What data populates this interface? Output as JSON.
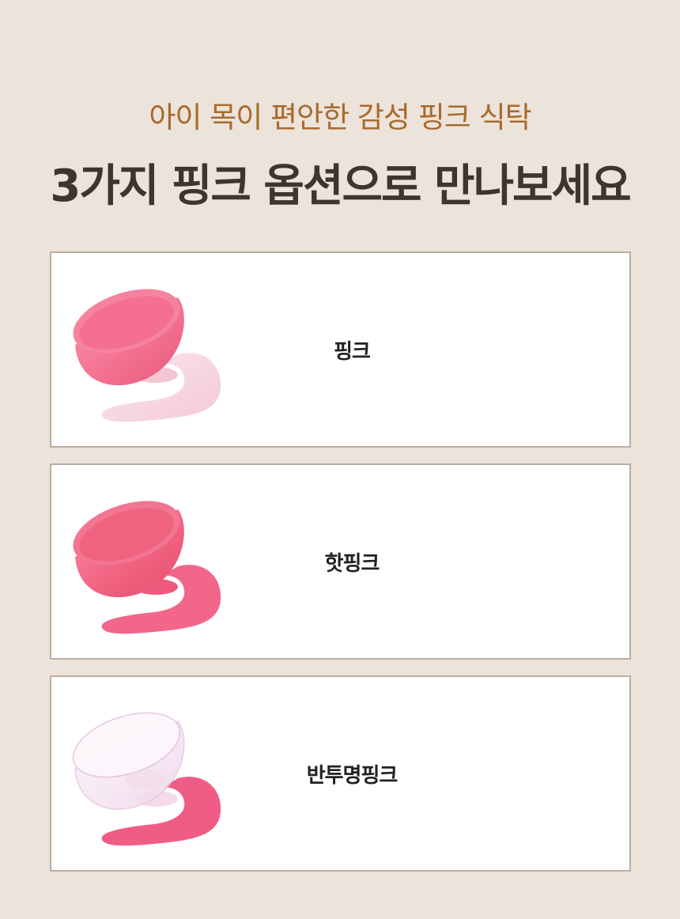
{
  "header": {
    "subtitle": "아이 목이 편안한 감성 핑크 식탁",
    "title": "3가지 핑크 옵션으로 만나보세요"
  },
  "options": [
    {
      "label": "핑크",
      "bowl_color": "#f26f8e",
      "base_color": "#f7d9e2"
    },
    {
      "label": "핫핑크",
      "bowl_color": "#f0617f",
      "base_color": "#f2668a"
    },
    {
      "label": "반투명핑크",
      "bowl_color": "#f4e6f3",
      "base_color": "#ef5d86"
    }
  ]
}
